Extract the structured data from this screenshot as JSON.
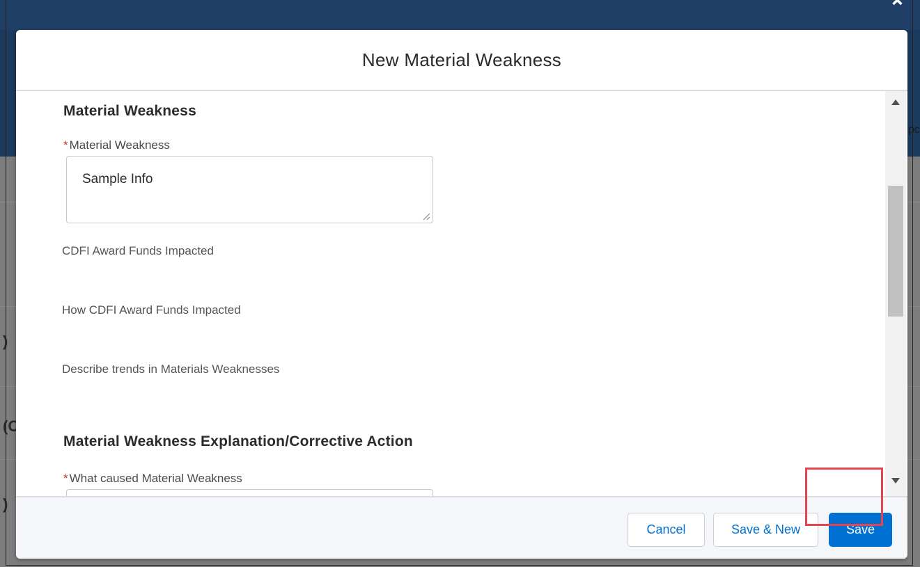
{
  "modal": {
    "title": "New Material Weakness",
    "sections": [
      {
        "title": "Material Weakness",
        "fields": [
          {
            "label": "Material Weakness",
            "required": "*",
            "value": "Sample Info"
          },
          {
            "label": "CDFI Award Funds Impacted"
          },
          {
            "label": "How CDFI Award Funds Impacted"
          },
          {
            "label": "Describe trends in Materials Weaknesses"
          }
        ]
      },
      {
        "title": "Material Weakness Explanation/Corrective Action",
        "fields": [
          {
            "label": "What caused Material Weakness",
            "required": "*",
            "value": ""
          }
        ]
      }
    ]
  },
  "footer": {
    "cancel_label": "Cancel",
    "save_new_label": "Save & New",
    "save_label": "Save"
  },
  "colors": {
    "brand": "#0070d2",
    "required": "#c23934",
    "highlight": "#e2474f",
    "backdrop_header": "#1b3a5e"
  },
  "background_fragments": {
    "right_text": "pc",
    "left_1": ")",
    "left_2": "(C",
    "left_3": ")"
  }
}
